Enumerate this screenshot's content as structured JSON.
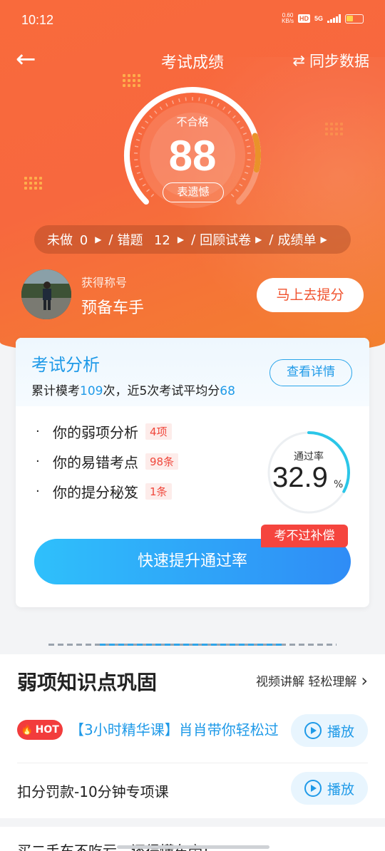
{
  "status_bar": {
    "time": "10:12",
    "net_speed_value": "0.60",
    "net_speed_unit": "KB/s",
    "hd": "HD",
    "signal": "5G"
  },
  "nav": {
    "back_icon": "arrow-left-icon",
    "title": "考试成绩",
    "sync_label": "同步数据"
  },
  "score": {
    "status": "不合格",
    "value": "88",
    "comment": "表遗憾",
    "progress": 0.88
  },
  "links": {
    "undone_label": "未做",
    "undone_count": "0",
    "wrong_label": "错题",
    "wrong_count": "12",
    "review_label": "回顾试卷",
    "report_label": "成绩单"
  },
  "profile": {
    "title_label": "获得称号",
    "title_value": "预备车手",
    "improve_button": "马上去提分"
  },
  "analysis": {
    "title": "考试分析",
    "sub_prefix": "累计模考",
    "sub_count": "109",
    "sub_mid": "次，近5次考试平均分",
    "sub_avg": "68",
    "detail_button": "查看详情",
    "items": [
      {
        "label": "你的弱项分析",
        "badge": "4项"
      },
      {
        "label": "你的易错考点",
        "badge": "98条"
      },
      {
        "label": "你的提分秘笈",
        "badge": "1条"
      }
    ],
    "pass_rate_label": "通过率",
    "pass_rate_value": "32.9",
    "pass_rate_unit": "%",
    "pass_rate": 0.329,
    "pass_button": "快速提升通过率",
    "compensate_tag": "考不过补偿"
  },
  "weak_section": {
    "title": "弱项知识点巩固",
    "more_label": "视频讲解 轻松理解",
    "courses": [
      {
        "hot": "HOT",
        "title": "【3小时精华课】肖肖带你轻松过",
        "play": "播放"
      },
      {
        "title": "扣分罚款-10分钟专项课",
        "play": "播放"
      }
    ]
  },
  "next_section": {
    "title": "买二手车不吃亏，还得懂车帝！"
  },
  "colors": {
    "header_orange": "#f7683e",
    "accent_blue": "#1f9ae8",
    "danger_red": "#f23c3c"
  }
}
